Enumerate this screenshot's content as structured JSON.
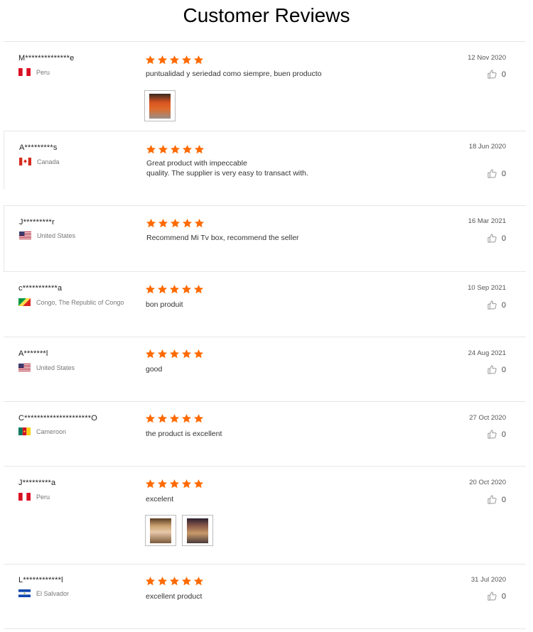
{
  "page": {
    "title": "Customer Reviews"
  },
  "reviews": [
    {
      "name": "M**************e",
      "country": "Peru",
      "rating": 5,
      "text": "puntualidad y seriedad como siempre, buen producto",
      "date": "12 Nov 2020",
      "likes": "0"
    },
    {
      "name": "A*********s",
      "country": "Canada",
      "rating": 5,
      "text": "Great product with impeccable\nquality. The supplier is very easy to transact with.",
      "date": "18 Jun 2020",
      "likes": "0"
    },
    {
      "name": "J*********r",
      "country": "United States",
      "rating": 5,
      "text": "Recommend Mi Tv box, recommend the seller",
      "date": "16 Mar 2021",
      "likes": "0"
    },
    {
      "name": "c***********a",
      "country": "Congo, The Republic of Congo",
      "rating": 5,
      "text": "bon produit",
      "date": "10 Sep 2021",
      "likes": "0"
    },
    {
      "name": "A*******l",
      "country": "United States",
      "rating": 5,
      "text": "good",
      "date": "24 Aug 2021",
      "likes": "0"
    },
    {
      "name": "C*********************O",
      "country": "Cameroon",
      "rating": 5,
      "text": "the product is excellent",
      "date": "27 Oct 2020",
      "likes": "0"
    },
    {
      "name": "J*********a",
      "country": "Peru",
      "rating": 5,
      "text": "excelent",
      "date": "20 Oct 2020",
      "likes": "0"
    },
    {
      "name": "L************l",
      "country": "El Salvador",
      "rating": 5,
      "text": "excellent product",
      "date": "31 Jul 2020",
      "likes": "0"
    }
  ],
  "icons": {
    "star": "star-icon",
    "like": "thumbs-up-icon",
    "flag": "country-flag-icon"
  },
  "colors": {
    "star": "#ff6a00",
    "divider": "#e6e6e6"
  }
}
